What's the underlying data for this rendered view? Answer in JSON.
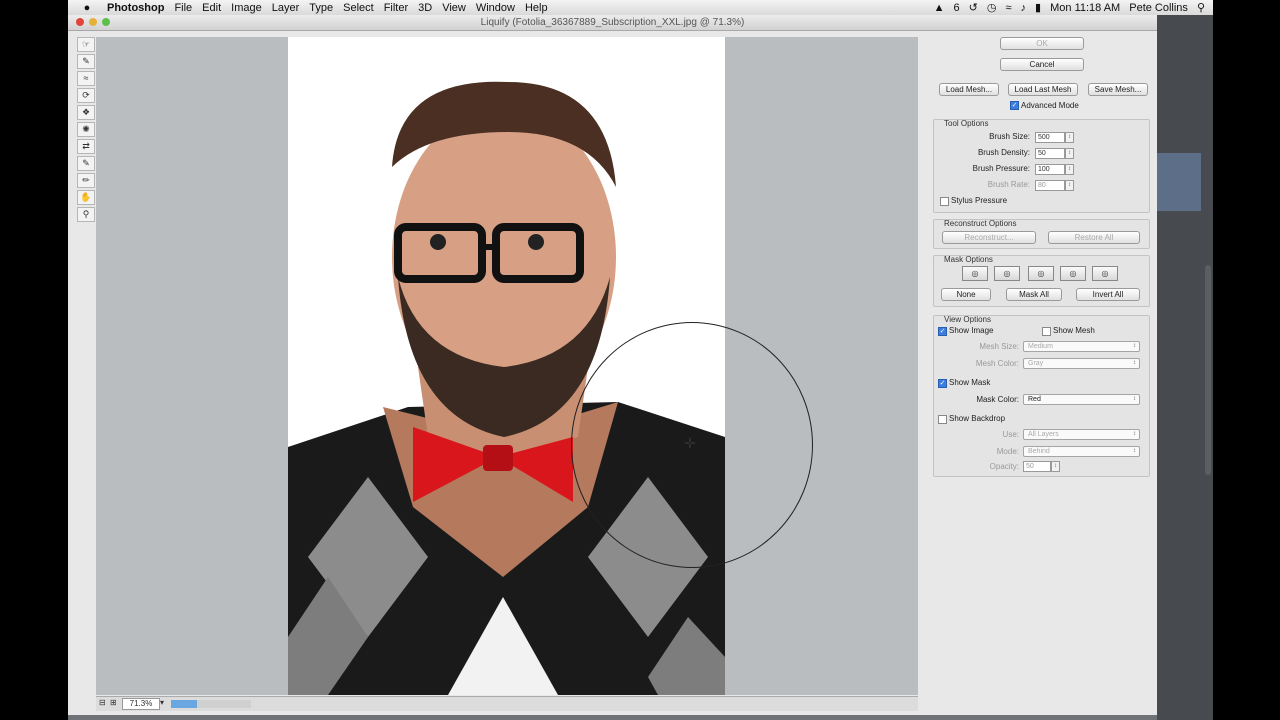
{
  "menubar": {
    "app_name": "Photoshop",
    "menus": [
      "File",
      "Edit",
      "Image",
      "Layer",
      "Type",
      "Select",
      "Filter",
      "3D",
      "View",
      "Window",
      "Help"
    ],
    "status_badge": "6",
    "clock": "Mon 11:18 AM",
    "user": "Pete Collins"
  },
  "window": {
    "title": "Liquify (Fotolia_36367889_Subscription_XXL.jpg @ 71.3%)"
  },
  "status": {
    "zoom": "71.3%",
    "progress_fraction": 0.32
  },
  "panel": {
    "ok_label": "OK",
    "cancel_label": "Cancel",
    "load_mesh_label": "Load Mesh...",
    "load_last_mesh_label": "Load Last Mesh",
    "save_mesh_label": "Save Mesh...",
    "advanced_mode_label": "Advanced Mode",
    "tool_options": {
      "title": "Tool Options",
      "brush_size_label": "Brush Size:",
      "brush_size": "500",
      "brush_density_label": "Brush Density:",
      "brush_density": "50",
      "brush_pressure_label": "Brush Pressure:",
      "brush_pressure": "100",
      "brush_rate_label": "Brush Rate:",
      "brush_rate": "80",
      "stylus_pressure_label": "Stylus Pressure"
    },
    "reconstruct_options": {
      "title": "Reconstruct Options",
      "reconstruct_label": "Reconstruct...",
      "restore_all_label": "Restore All"
    },
    "mask_options": {
      "title": "Mask Options",
      "none_label": "None",
      "mask_all_label": "Mask All",
      "invert_all_label": "Invert All"
    },
    "view_options": {
      "title": "View Options",
      "show_image_label": "Show Image",
      "show_mesh_label": "Show Mesh",
      "mesh_size_label": "Mesh Size:",
      "mesh_size": "Medium",
      "mesh_color_label": "Mesh Color:",
      "mesh_color": "Gray",
      "show_mask_label": "Show Mask",
      "mask_color_label": "Mask Color:",
      "mask_color": "Red",
      "show_backdrop_label": "Show Backdrop",
      "use_label": "Use:",
      "use": "All Layers",
      "mode_label": "Mode:",
      "mode": "Behind",
      "opacity_label": "Opacity:",
      "opacity": "50"
    }
  }
}
